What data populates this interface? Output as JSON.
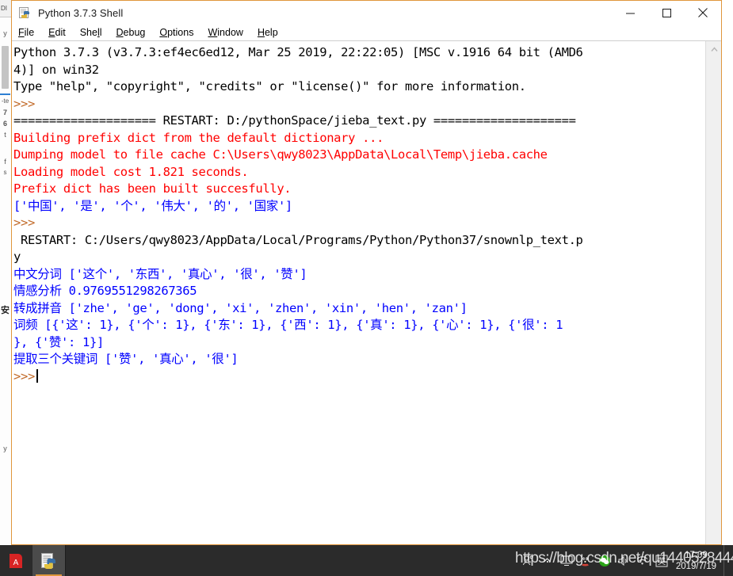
{
  "window": {
    "title": "Python 3.7.3 Shell",
    "app_icon": "python-idle-icon",
    "border_color": "#e0963c",
    "controls": {
      "minimize": "—",
      "maximize": "☐",
      "close": "✕"
    }
  },
  "menu": {
    "items": [
      {
        "mnemonic": "F",
        "rest": "ile"
      },
      {
        "mnemonic": "E",
        "rest": "dit"
      },
      {
        "pre": "She",
        "mnemonic": "l",
        "rest": "l"
      },
      {
        "mnemonic": "D",
        "rest": "ebug"
      },
      {
        "mnemonic": "O",
        "rest": "ptions"
      },
      {
        "mnemonic": "W",
        "rest": "indow"
      },
      {
        "mnemonic": "H",
        "rest": "elp"
      }
    ]
  },
  "colors": {
    "stdout_black": "#000000",
    "stderr_red": "#ff0000",
    "output_blue": "#0000ff",
    "prompt_brown": "#c26b2a",
    "taskbar": "#2b2b2b",
    "accent": "#e0963c"
  },
  "shell": {
    "lines": [
      {
        "color": "black",
        "text": "Python 3.7.3 (v3.7.3:ef4ec6ed12, Mar 25 2019, 22:22:05) [MSC v.1916 64 bit (AMD6"
      },
      {
        "color": "black",
        "text": "4)] on win32"
      },
      {
        "color": "black",
        "text": "Type \"help\", \"copyright\", \"credits\" or \"license()\" for more information."
      },
      {
        "color": "prompt",
        "text": ">>>"
      },
      {
        "color": "black",
        "text": "==================== RESTART: D:/pythonSpace/jieba_text.py ===================="
      },
      {
        "color": "red",
        "text": "Building prefix dict from the default dictionary ..."
      },
      {
        "color": "red",
        "text": "Dumping model to file cache C:\\Users\\qwy8023\\AppData\\Local\\Temp\\jieba.cache"
      },
      {
        "color": "red",
        "text": "Loading model cost 1.821 seconds."
      },
      {
        "color": "red",
        "text": "Prefix dict has been built succesfully."
      },
      {
        "color": "blue",
        "text": "['中国', '是', '个', '伟大', '的', '国家']"
      },
      {
        "color": "prompt",
        "text": ">>>"
      },
      {
        "color": "black",
        "text": " RESTART: C:/Users/qwy8023/AppData/Local/Programs/Python/Python37/snownlp_text.p"
      },
      {
        "color": "black",
        "text": "y"
      },
      {
        "color": "blue",
        "text": "中文分词 ['这个', '东西', '真心', '很', '赞']"
      },
      {
        "color": "blue",
        "text": "情感分析 0.9769551298267365"
      },
      {
        "color": "blue",
        "text": "转成拼音 ['zhe', 'ge', 'dong', 'xi', 'zhen', 'xin', 'hen', 'zan']"
      },
      {
        "color": "blue",
        "text": "词频 [{'这': 1}, {'个': 1}, {'东': 1}, {'西': 1}, {'真': 1}, {'心': 1}, {'很': 1"
      },
      {
        "color": "blue",
        "text": "}, {'赞': 1}]"
      },
      {
        "color": "blue",
        "text": "提取三个关键词 ['赞', '真心', '很']"
      },
      {
        "color": "prompt",
        "text": ">>>",
        "caret": true
      }
    ]
  },
  "scrollbar": {
    "up_arrow": "chevron-up-icon"
  },
  "taskbar": {
    "buttons": [
      {
        "name": "pdf-reader-taskbar-icon",
        "label": ""
      },
      {
        "name": "python-idle-taskbar-icon",
        "label": "",
        "active": true
      }
    ],
    "tray": {
      "people_icon": "ლͱ",
      "clock_time": "17:09",
      "clock_date": "2019/7/19"
    }
  },
  "watermark": {
    "text": "https://blog.csdn.net/qu1440528444"
  },
  "background_window": {
    "tab_label": "DI",
    "side_marks": [
      "y",
      "-te",
      "7",
      "6",
      "t",
      "f",
      "s"
    ],
    "cjk_mark": "安"
  }
}
